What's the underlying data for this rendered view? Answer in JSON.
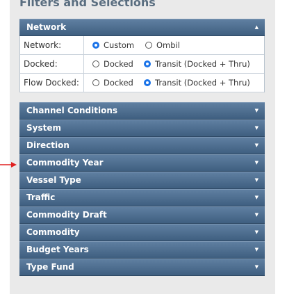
{
  "title": "Filters and Selections",
  "network_section": {
    "label": "Network",
    "chevron_icon": "chevron-up-icon",
    "rows": [
      {
        "label": "Network:",
        "options": [
          {
            "label": "Custom",
            "selected": true
          },
          {
            "label": "Ombil",
            "selected": false
          }
        ]
      },
      {
        "label": "Docked:",
        "options": [
          {
            "label": "Docked",
            "selected": false
          },
          {
            "label": "Transit (Docked + Thru)",
            "selected": true
          }
        ]
      },
      {
        "label": "Flow Docked:",
        "options": [
          {
            "label": "Docked",
            "selected": false
          },
          {
            "label": "Transit (Docked + Thru)",
            "selected": true
          }
        ]
      }
    ]
  },
  "sections": [
    {
      "label": "Channel Conditions"
    },
    {
      "label": "System"
    },
    {
      "label": "Direction"
    },
    {
      "label": "Commodity Year"
    },
    {
      "label": "Vessel Type"
    },
    {
      "label": "Traffic"
    },
    {
      "label": "Commodity Draft"
    },
    {
      "label": "Commodity"
    },
    {
      "label": "Budget Years"
    },
    {
      "label": "Type Fund"
    }
  ],
  "colors": {
    "header_bar": "#4d6d8e",
    "arrow": "#e02020",
    "radio_selected": "#1a73e8"
  }
}
